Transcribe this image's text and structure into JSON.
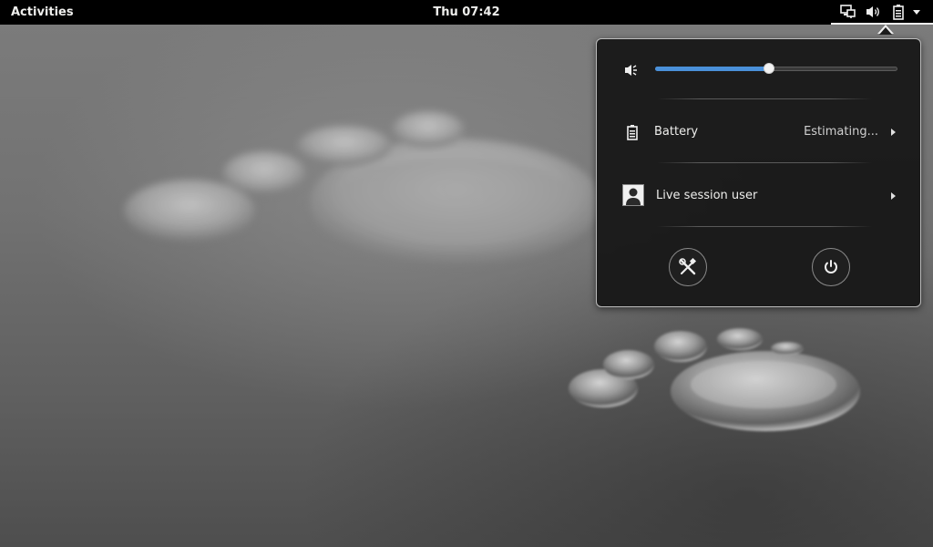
{
  "top_bar": {
    "activities_label": "Activities",
    "clock_text": "Thu 07:42",
    "tray_icons": [
      "network-wired-icon",
      "audio-volume-icon",
      "battery-icon",
      "chevron-down-icon"
    ]
  },
  "system_menu": {
    "volume": {
      "icon": "audio-volume-icon",
      "level_fraction": 0.47
    },
    "battery": {
      "icon": "battery-icon",
      "label": "Battery",
      "status": "Estimating..."
    },
    "user": {
      "icon": "avatar",
      "label": "Live session user"
    },
    "buttons": [
      {
        "name": "settings-button",
        "icon": "tools-icon"
      },
      {
        "name": "power-button",
        "icon": "power-icon"
      }
    ]
  },
  "colors": {
    "top_bar": "#000000",
    "menu_background": "#181818",
    "menu_border": "#bdbdbd",
    "slider_fill": "#4a90d9",
    "text": "#eeeeec"
  }
}
